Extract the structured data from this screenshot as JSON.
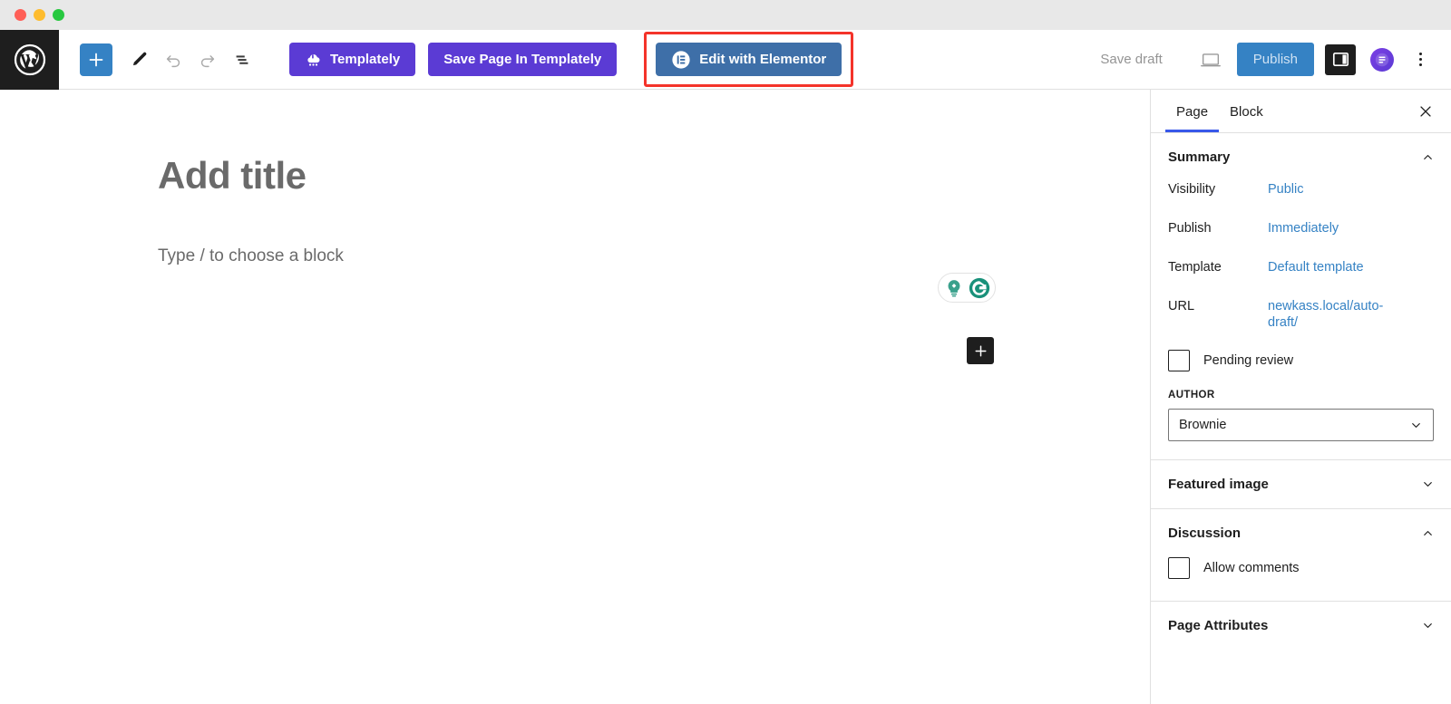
{
  "window": {
    "traffic_lights": [
      "close",
      "minimize",
      "maximize"
    ],
    "colors": {
      "close": "#ff5f57",
      "minimize": "#febc2e",
      "maximize": "#28c840"
    }
  },
  "toolbar": {
    "wp_logo_label": "W",
    "icons": [
      {
        "name": "block-inserter-icon",
        "label": "Toggle block inserter"
      },
      {
        "name": "pencil-icon",
        "label": "Tools"
      },
      {
        "name": "undo-icon",
        "label": "Undo"
      },
      {
        "name": "redo-icon",
        "label": "Redo"
      },
      {
        "name": "list-view-icon",
        "label": "Document overview"
      }
    ],
    "plugin_buttons": [
      {
        "name": "templately-button",
        "label": "Templately",
        "color": "#5b3bd4",
        "icon": "templately-cloud-icon"
      },
      {
        "name": "save-page-templately-button",
        "label": "Save Page In Templately",
        "color": "#5b3bd4",
        "icon": null
      },
      {
        "name": "edit-with-elementor-button",
        "label": "Edit with Elementor",
        "color": "#3e6fa8",
        "icon": "elementor-icon"
      }
    ],
    "highlight_color": "#f4332a",
    "save_draft_label": "Save draft",
    "preview_label": "Preview",
    "publish_label": "Publish",
    "publish_color": "#3582c4",
    "settings_toggle_label": "Settings",
    "jetpack_label": "Jetpack",
    "options_label": "Options"
  },
  "canvas": {
    "title_placeholder": "Add title",
    "block_placeholder": "Type / to choose a block",
    "assist_badge": {
      "icons": [
        "lightbulb-icon",
        "grammarly-g-icon"
      ],
      "color": "#2f9c85"
    },
    "add_block_label": "Add block"
  },
  "sidebar": {
    "tabs": [
      {
        "name": "tab-page",
        "label": "Page",
        "active": true
      },
      {
        "name": "tab-block",
        "label": "Block",
        "active": false
      }
    ],
    "close_label": "Close settings",
    "panels": [
      {
        "name": "summary-panel",
        "title": "Summary",
        "expanded": true,
        "rows": [
          {
            "label": "Visibility",
            "value": "Public"
          },
          {
            "label": "Publish",
            "value": "Immediately"
          },
          {
            "label": "Template",
            "value": "Default template"
          },
          {
            "label": "URL",
            "value": "newkass.local/auto-draft/"
          }
        ],
        "checkbox": {
          "label": "Pending review",
          "checked": false
        },
        "author_label": "AUTHOR",
        "author_value": "Brownie"
      },
      {
        "name": "featured-image-panel",
        "title": "Featured image",
        "expanded": false
      },
      {
        "name": "discussion-panel",
        "title": "Discussion",
        "expanded": true,
        "checkbox": {
          "label": "Allow comments",
          "checked": false
        }
      },
      {
        "name": "page-attributes-panel",
        "title": "Page Attributes",
        "expanded": false
      }
    ]
  }
}
